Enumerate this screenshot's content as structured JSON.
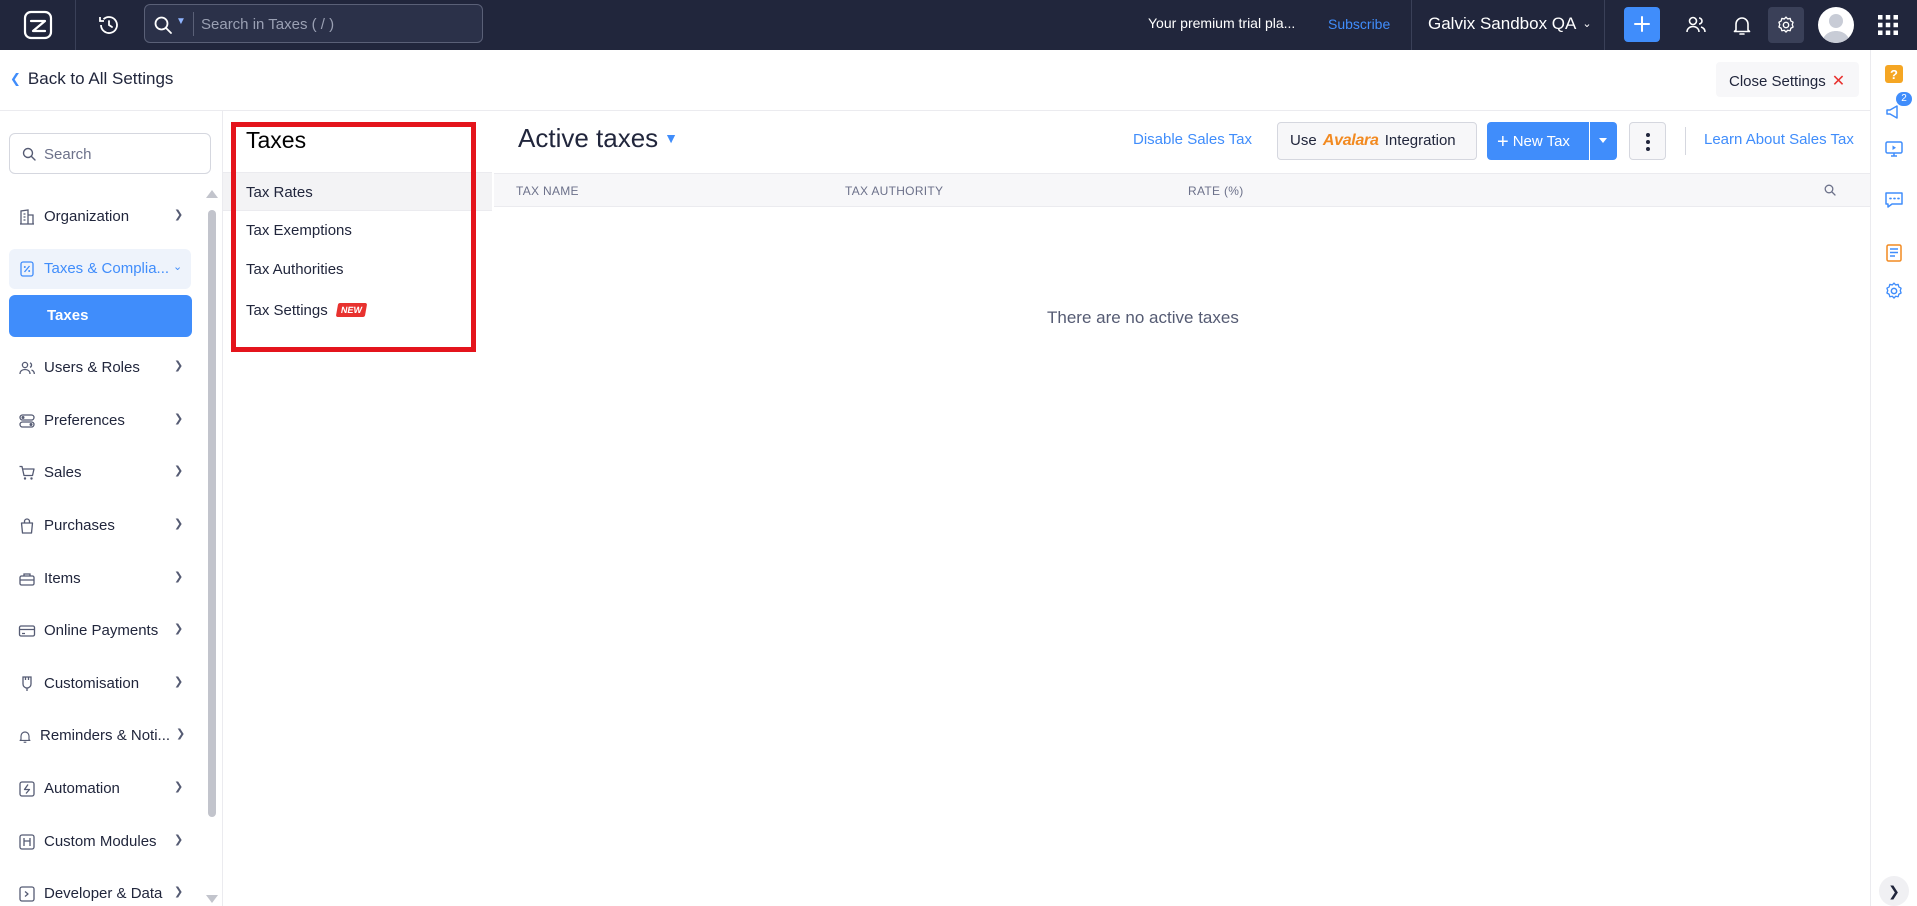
{
  "topbar": {
    "search_placeholder": "Search in Taxes ( / )",
    "trial_text": "Your premium trial pla...",
    "subscribe_label": "Subscribe",
    "org_name": "Galvix Sandbox QA"
  },
  "settings_header": {
    "back_label": "Back to All Settings",
    "close_label": "Close Settings"
  },
  "nav": {
    "search_placeholder": "Search",
    "items": [
      {
        "label": "Organization",
        "icon": "building-icon"
      },
      {
        "label": "Taxes & Complia...",
        "icon": "tax-percent-icon",
        "expanded": true
      },
      {
        "label": "Users & Roles",
        "icon": "users-icon"
      },
      {
        "label": "Preferences",
        "icon": "toggles-icon"
      },
      {
        "label": "Sales",
        "icon": "cart-icon"
      },
      {
        "label": "Purchases",
        "icon": "bag-icon"
      },
      {
        "label": "Items",
        "icon": "basket-icon"
      },
      {
        "label": "Online Payments",
        "icon": "card-icon"
      },
      {
        "label": "Customisation",
        "icon": "brush-icon"
      },
      {
        "label": "Reminders & Noti...",
        "icon": "bell-icon"
      },
      {
        "label": "Automation",
        "icon": "automation-icon"
      },
      {
        "label": "Custom Modules",
        "icon": "modules-icon"
      },
      {
        "label": "Developer & Data",
        "icon": "code-icon"
      }
    ],
    "active_sub": "Taxes"
  },
  "subnav": {
    "title": "Taxes",
    "items": [
      {
        "label": "Tax Rates",
        "active": true
      },
      {
        "label": "Tax Exemptions"
      },
      {
        "label": "Tax Authorities"
      },
      {
        "label": "Tax Settings",
        "badge": "NEW"
      }
    ]
  },
  "main": {
    "title": "Active taxes",
    "disable_label": "Disable Sales Tax",
    "avalara": {
      "prefix": "Use",
      "brand": "Avalara",
      "suffix": "Integration"
    },
    "new_tax_label": "New Tax",
    "learn_label": "Learn About Sales Tax",
    "columns": [
      "TAX NAME",
      "TAX AUTHORITY",
      "RATE (%)"
    ],
    "empty_message": "There are no active taxes"
  },
  "rail": {
    "notification_count": "2"
  },
  "colors": {
    "topbar_bg": "#21263c",
    "accent": "#408dfb",
    "highlight": "#e4141c",
    "avalara": "#f28a21"
  }
}
